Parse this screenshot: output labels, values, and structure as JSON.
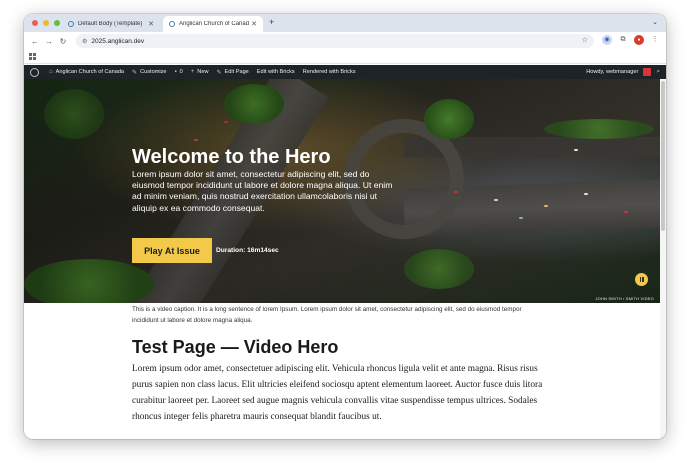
{
  "browser": {
    "tabs": [
      {
        "label": "Default Body (Template)",
        "active": false
      },
      {
        "label": "Anglican Church of Canada",
        "active": true
      }
    ],
    "new_tab": "+",
    "url": "2025.anglican.dev"
  },
  "admin_bar": {
    "site_name": "Anglican Church of Canada",
    "customize": "Customize",
    "comments_count": "0",
    "new": "New",
    "edit_page": "Edit Page",
    "edit_with_bricks": "Edit with Bricks",
    "rendered_with_bricks": "Rendered with Bricks",
    "howdy": "Howdy, webmanager"
  },
  "hero": {
    "title": "Welcome to the Hero",
    "description": "Lorem ipsum dolor sit amet, consectetur adipiscing elit, sed do eiusmod tempor incididunt ut labore et dolore magna aliqua. Ut enim ad minim veniam, quis nostrud exercitation ullamcolaboris nisi ut aliquip ex ea commodo consequat.",
    "cta_label": "Play At Issue",
    "duration": "Duration: 16m14sec",
    "credit": "JOHN SMITH / SMITH VIDEO"
  },
  "content": {
    "caption": "This is a video caption. It is a long sentence of lorem Ipsum. Lorem ipsum dolor sit amet, consectetur adipiscing elit, sed do eiusmod tempor incididunt ut labore et dolore magna aliqua.",
    "title": "Test Page — Video Hero",
    "body": "Lorem ipsum odor amet, consectetuer adipiscing elit. Vehicula rhoncus ligula velit et ante magna. Risus risus purus sapien non class lacus. Elit ultricies eleifend sociosqu aptent elementum laoreet. Auctor fusce duis litora curabitur laoreet per. Laoreet sed augue magnis vehicula convallis vitae suspendisse tempus ultrices. Sodales rhoncus integer felis pharetra mauris consequat blandit faucibus ut."
  },
  "colors": {
    "accent": "#f3c94a",
    "admin_bar": "#1d2327"
  },
  "icons": [
    "back-arrow-icon",
    "forward-arrow-icon",
    "reload-icon",
    "site-info-icon",
    "star-icon",
    "extensions-icon",
    "menu-icon",
    "wordpress-icon",
    "paint-brush-icon",
    "comment-icon",
    "plus-icon",
    "pencil-icon",
    "search-icon",
    "pause-icon",
    "apps-grid-icon"
  ]
}
